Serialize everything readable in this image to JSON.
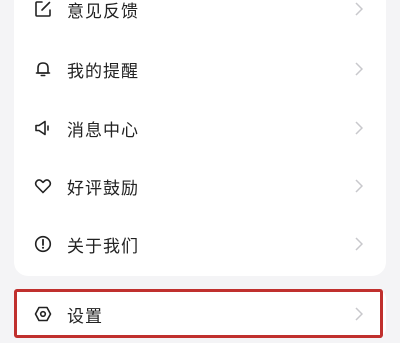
{
  "menu": {
    "items": [
      {
        "label": "意见反馈",
        "icon": "edit-note-icon"
      },
      {
        "label": "我的提醒",
        "icon": "bell-icon"
      },
      {
        "label": "消息中心",
        "icon": "speaker-icon"
      },
      {
        "label": "好评鼓励",
        "icon": "heart-icon"
      },
      {
        "label": "关于我们",
        "icon": "info-icon"
      }
    ]
  },
  "settings": {
    "label": "设置",
    "icon": "gear-icon"
  },
  "colors": {
    "background": "#f4f4f6",
    "card": "#ffffff",
    "text": "#222222",
    "chevron": "#c8c8cc",
    "highlight": "#c0302e"
  }
}
